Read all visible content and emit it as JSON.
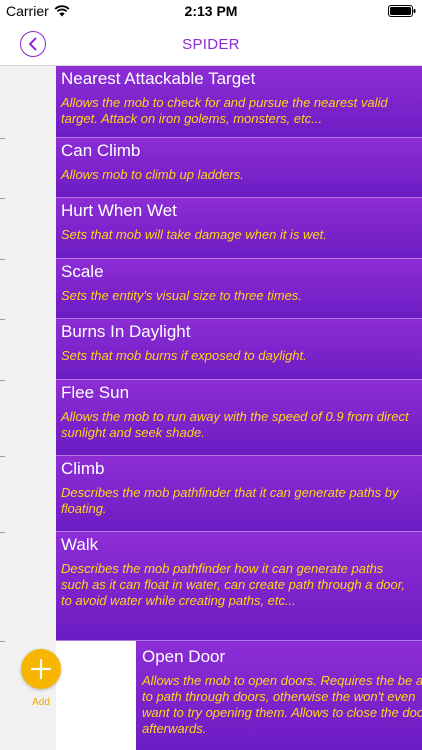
{
  "status_bar": {
    "carrier": "Carrier",
    "time": "2:13 PM"
  },
  "nav": {
    "title": "SPIDER"
  },
  "components": [
    {
      "title": "Nearest Attackable Target",
      "description": "Allows the mob to check for and pursue the nearest valid target. Attack on iron golems, monsters, etc..."
    },
    {
      "title": "Can Climb",
      "description": "Allows mob to climb up ladders."
    },
    {
      "title": "Hurt When Wet",
      "description": "Sets that mob will take damage when it is wet."
    },
    {
      "title": "Scale",
      "description": "Sets the entity's visual size to three times."
    },
    {
      "title": "Burns In Daylight",
      "description": "Sets that mob burns if exposed to daylight."
    },
    {
      "title": "Flee Sun",
      "description": "Allows the mob to run away with the speed of 0.9 from direct sunlight and seek shade."
    },
    {
      "title": "Climb",
      "description": "Describes the mob pathfinder that it can generate paths by floating."
    },
    {
      "title": "Walk",
      "description": "Describes the mob pathfinder how it can generate paths such as it can float in water, can create path through a door, to avoid water while creating paths, etc..."
    }
  ],
  "last_component": {
    "title": "Open Door",
    "description": "Allows the mob to open doors. Requires the be able to path through doors, otherwise the won't even want to try opening them. Allows to close the door afterwards."
  },
  "add": {
    "label": "Add"
  },
  "colors": {
    "accent": "#8b2ad6",
    "row_top": "#8d2dd6",
    "row_bottom": "#6c1cc3",
    "description": "#ffd419",
    "add_button": "#f7b500"
  }
}
